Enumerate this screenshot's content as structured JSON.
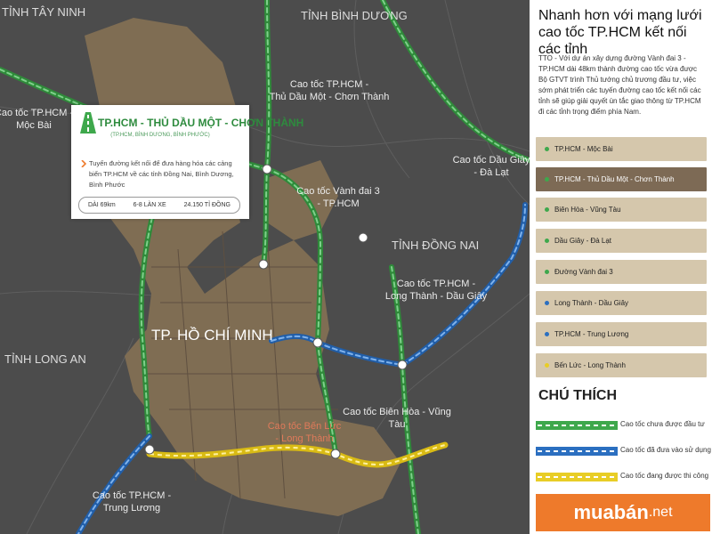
{
  "map": {
    "provinces": [
      {
        "label": "TỈNH TÂY NINH"
      },
      {
        "label": "TỈNH BÌNH DƯƠNG"
      },
      {
        "label": "TỈNH ĐỒNG NAI"
      },
      {
        "label": "TỈNH LONG AN"
      },
      {
        "label": "TP. HỒ CHÍ MINH"
      }
    ],
    "road_labels": [
      {
        "line1": "Cao tốc TP.HCM -",
        "line2": "Mộc Bài"
      },
      {
        "line1": "Cao tốc TP.HCM -",
        "line2": "Thủ Dầu Một - Chơn Thành"
      },
      {
        "line1": "Cao tốc Vành đai 3",
        "line2": "- TP.HCM"
      },
      {
        "line1": "Cao tốc Dầu Giây",
        "line2": "- Đà Lạt"
      },
      {
        "line1": "Cao tốc TP.HCM -",
        "line2": "Long Thành - Dầu Giây"
      },
      {
        "line1": "Cao tốc Bến Lức",
        "line2": "- Long Thành"
      },
      {
        "line1": "Cao tốc Biên Hòa - Vũng",
        "line2": "Tàu"
      },
      {
        "line1": "Cao tốc TP.HCM -",
        "line2": "Trung Lương"
      }
    ]
  },
  "infobox": {
    "title": "TP.HCM - THỦ DẦU MỘT - CHƠN THÀNH",
    "subtitle": "(TP.HCM, BÌNH DƯƠNG, BÌNH PHƯỚC)",
    "description": "Tuyến đường kết nối để đưa hàng hóa các cảng biển TP.HCM về các tỉnh Đồng Nai, Bình Dương, Bình Phước",
    "stats": [
      "DÀI 69km",
      "6-8 LÀN XE",
      "24.150 TỈ ĐỒNG"
    ]
  },
  "panel": {
    "title": "Nhanh hơn với mạng lưới cao tốc TP.HCM kết nối các tỉnh",
    "description": "TTO - Với dự án xây dựng đường Vành đai 3 - TP.HCM dài 48km thành đường cao tốc vừa được Bộ GTVT trình Thủ tướng chủ trương đầu tư, việc sớm phát triển các tuyến đường cao tốc kết nối các tỉnh sẽ giúp giải quyết ùn tắc giao thông từ TP.HCM đi các tỉnh trọng điểm phía Nam.",
    "routes": [
      {
        "label": "TP.HCM - Mộc Bài",
        "status": "green",
        "active": false
      },
      {
        "label": "TP.HCM - Thủ Dầu Một - Chơn Thành",
        "status": "green",
        "active": true
      },
      {
        "label": "Biên Hòa - Vũng Tàu",
        "status": "green",
        "active": false
      },
      {
        "label": "Dầu Giây - Đà Lạt",
        "status": "green",
        "active": false
      },
      {
        "label": "Đường Vành đai 3",
        "status": "green",
        "active": false
      },
      {
        "label": "Long Thành - Dầu Giây",
        "status": "blue",
        "active": false
      },
      {
        "label": "TP.HCM - Trung Lương",
        "status": "blue",
        "active": false
      },
      {
        "label": "Bến Lức - Long Thành",
        "status": "yellow",
        "active": false
      }
    ]
  },
  "legend": {
    "title": "CHÚ THÍCH",
    "items": [
      {
        "label": "Cao tốc chưa được đầu tư",
        "color": "#3ea84c"
      },
      {
        "label": "Cao tốc đã đưa vào sử dụng",
        "color": "#2b6fc0"
      },
      {
        "label": "Cao tốc đang được thi công",
        "color": "#e8cd26"
      }
    ]
  },
  "colors": {
    "map_bg": "#4c4c4c",
    "city_fill": "#7f6d53",
    "green": "#3ea84c",
    "blue": "#2b6fc0",
    "yellow": "#e8cd26",
    "route_bg": "#d5c7ac",
    "route_active_bg": "#7d6a55",
    "logo_bg": "#ee7a2b"
  },
  "logo": {
    "main": "muabán",
    "suffix": ".net"
  }
}
